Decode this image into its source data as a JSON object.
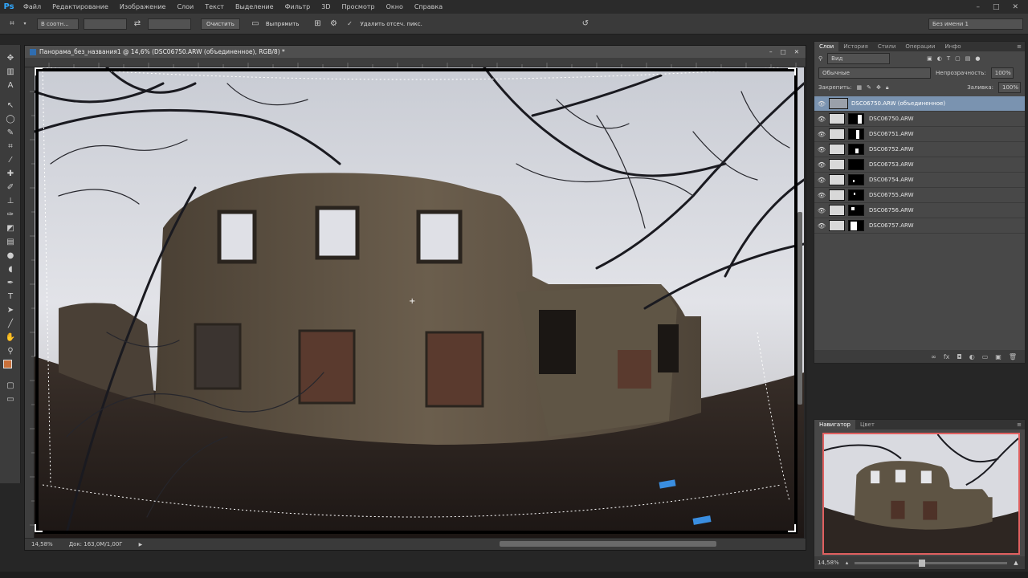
{
  "app": {
    "logo": "Ps"
  },
  "menu": [
    "Файл",
    "Редактирование",
    "Изображение",
    "Слои",
    "Текст",
    "Выделение",
    "Фильтр",
    "3D",
    "Просмотр",
    "Окно",
    "Справка"
  ],
  "window_controls": {
    "minimize": "–",
    "maximize": "□",
    "close": "✕"
  },
  "options_bar": {
    "ratio_value": "В соотн...",
    "width_value": "",
    "height_value": "",
    "clear_label": "Очистить",
    "straighten_label": "Выпрямить",
    "delete_crop_label": "Удалить отсеч. пикс.",
    "workspace_value": "Без имени 1"
  },
  "document": {
    "tab_title": "Панорама_без_названия1 @ 14,6% (DSC06750.ARW (объединенное), RGB/8) *",
    "zoom": "14,58%",
    "doc_info": "Док: 163,0M/1,00Г"
  },
  "layers_panel": {
    "tabs": [
      "Слои",
      "История",
      "Стили",
      "Операции",
      "Инфо"
    ],
    "filter_value": "Вид",
    "blend_mode": "Обычные",
    "opacity_label": "Непрозрачность:",
    "opacity_value": "100%",
    "lock_label": "Закрепить:",
    "fill_label": "Заливка:",
    "fill_value": "100%",
    "layers": [
      {
        "name": "DSC06750.ARW (объединенное)",
        "active": true
      },
      {
        "name": "DSC06750.ARW",
        "active": false
      },
      {
        "name": "DSC06751.ARW",
        "active": false
      },
      {
        "name": "DSC06752.ARW",
        "active": false
      },
      {
        "name": "DSC06753.ARW",
        "active": false
      },
      {
        "name": "DSC06754.ARW",
        "active": false
      },
      {
        "name": "DSC06755.ARW",
        "active": false
      },
      {
        "name": "DSC06756.ARW",
        "active": false
      },
      {
        "name": "DSC06757.ARW",
        "active": false
      }
    ]
  },
  "navigator_panel": {
    "tabs": [
      "Навигатор",
      "Цвет"
    ],
    "zoom": "14,58%"
  },
  "colors": {
    "foreground": "#c8703a",
    "background": "#000000",
    "accent": "#7a93b0",
    "nav_frame": "#e06060"
  }
}
